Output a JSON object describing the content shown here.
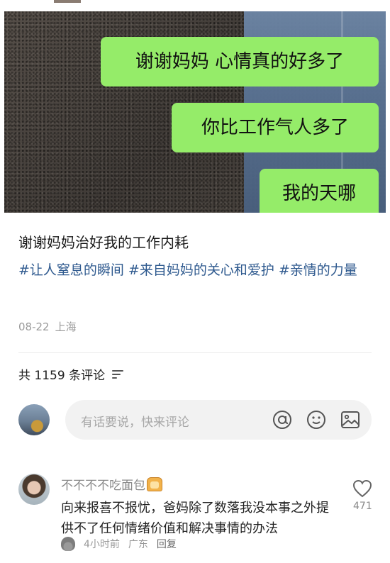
{
  "post": {
    "bubbles": [
      "谢谢妈妈 心情真的好多了",
      "你比工作气人多了",
      "我的天哪"
    ],
    "title": "谢谢妈妈治好我的工作内耗",
    "tags": [
      "#让人窒息的瞬间",
      "#来自妈妈的关心和爱护",
      "#亲情的力量"
    ],
    "date": "08-22",
    "location": "上海"
  },
  "comments_header": {
    "count_label": "共 1159 条评论",
    "sort_icon": "sort-icon"
  },
  "composer": {
    "placeholder": "有话要说，快来评论",
    "icons": [
      "at-icon",
      "emoji-icon",
      "image-icon"
    ]
  },
  "comment": {
    "username": "不不不不吃面包",
    "badge_icon": "bread-emoji-icon",
    "text": "向来报喜不报忧，爸妈除了数落我没本事之外提供不了任何情绪价值和解决事情的办法",
    "meta_icon": "poop-emoji-icon",
    "time": "4小时前",
    "location": "广东",
    "reply_label": "回复",
    "like_count": "471"
  },
  "colors": {
    "bubble_green": "#95ec69",
    "tag_blue": "#2f5a8f",
    "meta_gray": "#9a9a9a"
  }
}
